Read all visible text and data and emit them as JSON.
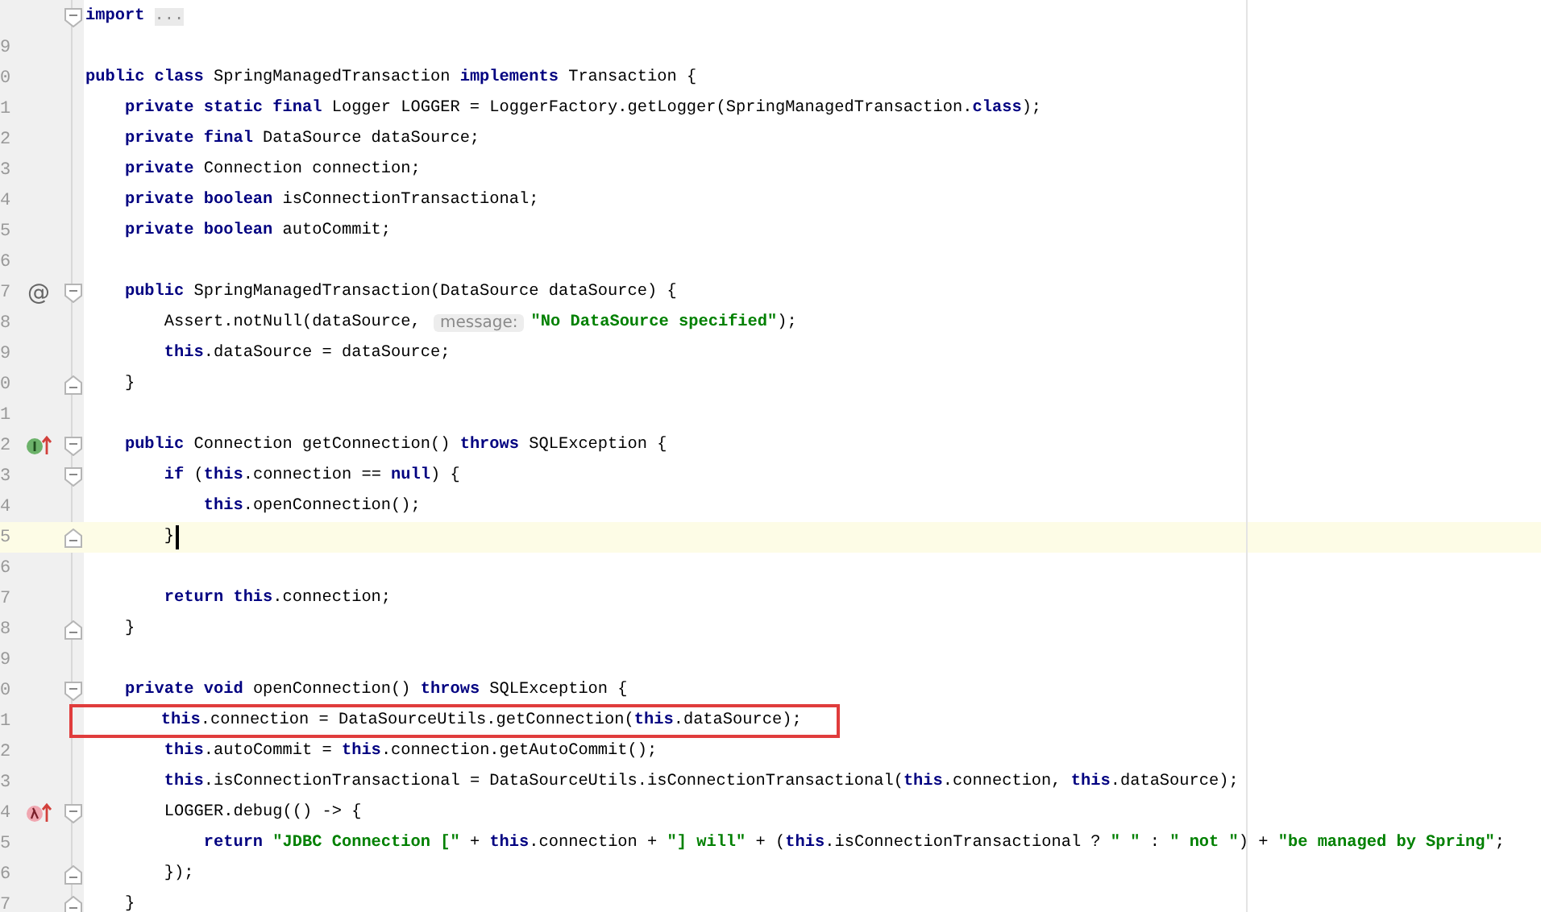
{
  "editor": {
    "lines": [
      {
        "fold": {
          "kind": "start"
        },
        "tokens": [
          {
            "kind": "keyword",
            "text": "import "
          },
          {
            "kind": "folded",
            "text": "..."
          }
        ]
      },
      {
        "number": "9"
      },
      {
        "number": "0",
        "tokens": [
          {
            "kind": "keyword",
            "text": "public class "
          },
          {
            "kind": "plain",
            "text": "SpringManagedTransaction "
          },
          {
            "kind": "keyword",
            "text": "implements "
          },
          {
            "kind": "plain",
            "text": "Transaction {"
          }
        ]
      },
      {
        "number": "1",
        "tokens": [
          {
            "kind": "keyword",
            "text": "    private static final "
          },
          {
            "kind": "plain",
            "text": "Logger LOGGER = LoggerFactory.getLogger(SpringManagedTransaction."
          },
          {
            "kind": "keyword",
            "text": "class"
          },
          {
            "kind": "plain",
            "text": ");"
          }
        ]
      },
      {
        "number": "2",
        "tokens": [
          {
            "kind": "keyword",
            "text": "    private final "
          },
          {
            "kind": "plain",
            "text": "DataSource dataSource;"
          }
        ]
      },
      {
        "number": "3",
        "tokens": [
          {
            "kind": "keyword",
            "text": "    private "
          },
          {
            "kind": "plain",
            "text": "Connection connection;"
          }
        ]
      },
      {
        "number": "4",
        "tokens": [
          {
            "kind": "keyword",
            "text": "    private boolean "
          },
          {
            "kind": "plain",
            "text": "isConnectionTransactional;"
          }
        ]
      },
      {
        "number": "5",
        "tokens": [
          {
            "kind": "keyword",
            "text": "    private boolean "
          },
          {
            "kind": "plain",
            "text": "autoCommit;"
          }
        ]
      },
      {
        "number": "6"
      },
      {
        "number": "7",
        "gutter": {
          "kind": "annotation",
          "glyph": "@"
        },
        "fold": {
          "kind": "start"
        },
        "tokens": [
          {
            "kind": "keyword",
            "text": "    public "
          },
          {
            "kind": "plain",
            "text": "SpringManagedTransaction(DataSource dataSource) {"
          }
        ]
      },
      {
        "number": "8",
        "tokens": [
          {
            "kind": "plain",
            "text": "        Assert.notNull(dataSource, "
          },
          {
            "kind": "hint",
            "text": "message:"
          },
          {
            "kind": "string",
            "text": "\"No DataSource specified\""
          },
          {
            "kind": "plain",
            "text": ");"
          }
        ]
      },
      {
        "number": "9",
        "tokens": [
          {
            "kind": "keyword",
            "text": "        this"
          },
          {
            "kind": "plain",
            "text": ".dataSource = dataSource;"
          }
        ]
      },
      {
        "number": "0",
        "fold": {
          "kind": "end"
        },
        "tokens": [
          {
            "kind": "plain",
            "text": "    }"
          }
        ]
      },
      {
        "number": "1"
      },
      {
        "number": "2",
        "gutter": {
          "kind": "implements"
        },
        "fold": {
          "kind": "start"
        },
        "tokens": [
          {
            "kind": "keyword",
            "text": "    public "
          },
          {
            "kind": "plain",
            "text": "Connection getConnection() "
          },
          {
            "kind": "keyword",
            "text": "throws "
          },
          {
            "kind": "plain",
            "text": "SQLException {"
          }
        ]
      },
      {
        "number": "3",
        "fold": {
          "kind": "start"
        },
        "tokens": [
          {
            "kind": "keyword",
            "text": "        if "
          },
          {
            "kind": "plain",
            "text": "("
          },
          {
            "kind": "keyword",
            "text": "this"
          },
          {
            "kind": "plain",
            "text": ".connection == "
          },
          {
            "kind": "keyword",
            "text": "null"
          },
          {
            "kind": "plain",
            "text": ") {"
          }
        ]
      },
      {
        "number": "4",
        "tokens": [
          {
            "kind": "keyword",
            "text": "            this"
          },
          {
            "kind": "plain",
            "text": ".openConnection();"
          }
        ]
      },
      {
        "number": "5",
        "fold": {
          "kind": "end"
        },
        "current": true,
        "caret": true,
        "tokens": [
          {
            "kind": "plain",
            "text": "        }"
          }
        ]
      },
      {
        "number": "6"
      },
      {
        "number": "7",
        "tokens": [
          {
            "kind": "keyword",
            "text": "        return this"
          },
          {
            "kind": "plain",
            "text": ".connection;"
          }
        ]
      },
      {
        "number": "8",
        "fold": {
          "kind": "end"
        },
        "tokens": [
          {
            "kind": "plain",
            "text": "    }"
          }
        ]
      },
      {
        "number": "9"
      },
      {
        "number": "0",
        "fold": {
          "kind": "start"
        },
        "tokens": [
          {
            "kind": "keyword",
            "text": "    private void "
          },
          {
            "kind": "plain",
            "text": "openConnection() "
          },
          {
            "kind": "keyword",
            "text": "throws "
          },
          {
            "kind": "plain",
            "text": "SQLException {"
          }
        ]
      },
      {
        "number": "1",
        "highlighted": true,
        "tokens": [
          {
            "kind": "keyword",
            "text": "        this"
          },
          {
            "kind": "plain",
            "text": ".connection = DataSourceUtils.getConnection("
          },
          {
            "kind": "keyword",
            "text": "this"
          },
          {
            "kind": "plain",
            "text": ".dataSource);"
          }
        ]
      },
      {
        "number": "2",
        "tokens": [
          {
            "kind": "keyword",
            "text": "        this"
          },
          {
            "kind": "plain",
            "text": ".autoCommit = "
          },
          {
            "kind": "keyword",
            "text": "this"
          },
          {
            "kind": "plain",
            "text": ".connection.getAutoCommit();"
          }
        ]
      },
      {
        "number": "3",
        "tokens": [
          {
            "kind": "keyword",
            "text": "        this"
          },
          {
            "kind": "plain",
            "text": ".isConnectionTransactional = DataSourceUtils.isConnectionTransactional("
          },
          {
            "kind": "keyword",
            "text": "this"
          },
          {
            "kind": "plain",
            "text": ".connection, "
          },
          {
            "kind": "keyword",
            "text": "this"
          },
          {
            "kind": "plain",
            "text": ".dataSource);"
          }
        ]
      },
      {
        "number": "4",
        "gutter": {
          "kind": "lambda"
        },
        "fold": {
          "kind": "start"
        },
        "tokens": [
          {
            "kind": "plain",
            "text": "        LOGGER.debug(() -> {"
          }
        ]
      },
      {
        "number": "5",
        "tokens": [
          {
            "kind": "keyword",
            "text": "            return "
          },
          {
            "kind": "string",
            "text": "\"JDBC Connection [\""
          },
          {
            "kind": "plain",
            "text": " + "
          },
          {
            "kind": "keyword",
            "text": "this"
          },
          {
            "kind": "plain",
            "text": ".connection + "
          },
          {
            "kind": "string",
            "text": "\"] will\""
          },
          {
            "kind": "plain",
            "text": " + ("
          },
          {
            "kind": "keyword",
            "text": "this"
          },
          {
            "kind": "plain",
            "text": ".isConnectionTransactional ? "
          },
          {
            "kind": "string",
            "text": "\" \""
          },
          {
            "kind": "plain",
            "text": " : "
          },
          {
            "kind": "string",
            "text": "\" not \""
          },
          {
            "kind": "plain",
            "text": ") + "
          },
          {
            "kind": "string",
            "text": "\"be managed by Spring\""
          },
          {
            "kind": "plain",
            "text": ";"
          }
        ]
      },
      {
        "number": "6",
        "fold": {
          "kind": "end"
        },
        "tokens": [
          {
            "kind": "plain",
            "text": "        });"
          }
        ]
      },
      {
        "number": "7",
        "fold": {
          "kind": "end"
        },
        "tokens": [
          {
            "kind": "plain",
            "text": "    }"
          }
        ]
      }
    ]
  }
}
